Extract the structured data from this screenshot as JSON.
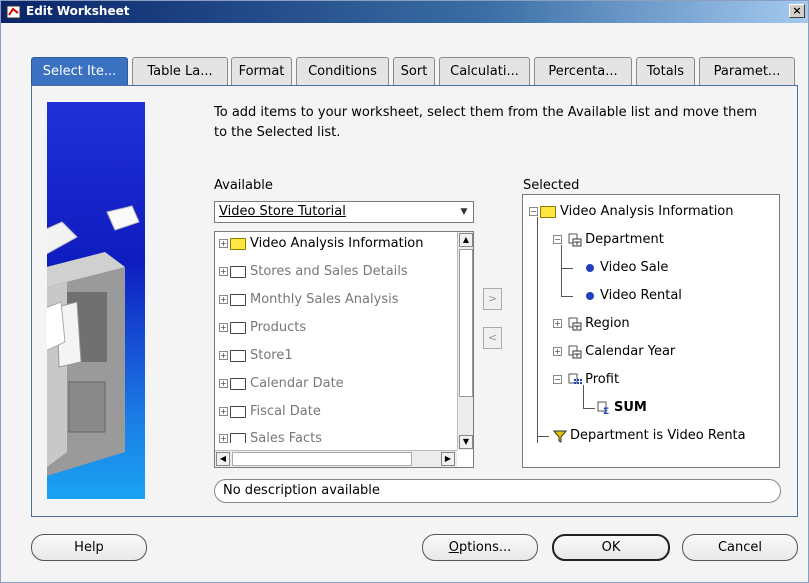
{
  "window": {
    "title": "Edit Worksheet",
    "close_glyph": "×"
  },
  "tabs": [
    {
      "label": "Select Ite...",
      "active": true
    },
    {
      "label": "Table La..."
    },
    {
      "label": "Format"
    },
    {
      "label": "Conditions"
    },
    {
      "label": "Sort"
    },
    {
      "label": "Calculati..."
    },
    {
      "label": "Percenta..."
    },
    {
      "label": "Totals"
    },
    {
      "label": "Paramet..."
    }
  ],
  "instructions": "To add items to your worksheet, select them from the Available list and move them to the Selected list.",
  "available": {
    "label": "Available",
    "dropdown_value": "Video Store Tutorial",
    "items": [
      {
        "label": "Video Analysis Information",
        "icon": "folder-yellow-icon",
        "enabled": true
      },
      {
        "label": "Stores and Sales Details",
        "icon": "folder-icon",
        "enabled": false
      },
      {
        "label": "Monthly Sales Analysis",
        "icon": "folder-icon",
        "enabled": false
      },
      {
        "label": "Products",
        "icon": "folder-icon",
        "enabled": false
      },
      {
        "label": "Store1",
        "icon": "folder-icon",
        "enabled": false
      },
      {
        "label": "Calendar Date",
        "icon": "folder-icon",
        "enabled": false
      },
      {
        "label": "Fiscal Date",
        "icon": "folder-icon",
        "enabled": false
      },
      {
        "label": "Sales Facts",
        "icon": "folder-icon",
        "enabled": false
      }
    ]
  },
  "move_buttons": {
    "add_glyph": ">",
    "remove_glyph": "<"
  },
  "selected": {
    "label": "Selected",
    "items": {
      "root": "Video Analysis Information",
      "department": "Department",
      "video_sale": "Video Sale",
      "video_rental": "Video Rental",
      "region": "Region",
      "calendar_year": "Calendar Year",
      "profit": "Profit",
      "sum": "SUM",
      "condition": "Department is Video Renta"
    }
  },
  "description": "No description available",
  "buttons": {
    "help": "Help",
    "options_prefix": "O",
    "options_rest": "ptions...",
    "ok": "OK",
    "cancel": "Cancel"
  },
  "colors": {
    "active_tab": "#3a71c0",
    "title_bar": "#0a246a",
    "folder_yellow": "#ffe640"
  }
}
